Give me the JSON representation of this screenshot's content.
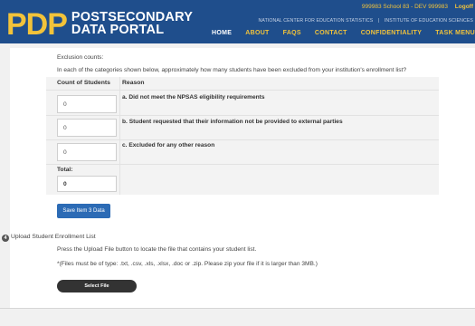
{
  "header": {
    "logo_mark": "PDP",
    "logo_line1": "POSTSECONDARY",
    "logo_line2": "DATA PORTAL",
    "session": "999983 School 83 - DEV 999983",
    "logoff": "Logoff",
    "org_left": "NATIONAL CENTER FOR EDUCATION STATISTICS",
    "org_sep": "|",
    "org_right": "INSTITUTE OF EDUCATION SCIENCES",
    "nav": [
      "HOME",
      "ABOUT",
      "FAQS",
      "CONTACT",
      "CONFIDENTIALITY",
      "TASK MENU"
    ]
  },
  "exclusion": {
    "heading": "Exclusion counts:",
    "question": "In each of the categories shown below, approximately how many students have been excluded from your institution's enrollment list?",
    "col_count": "Count of Students",
    "col_reason": "Reason",
    "rows": [
      {
        "value": "0",
        "reason": "a. Did not meet the NPSAS eligibility requirements"
      },
      {
        "value": "0",
        "reason": "b. Student requested that their information not be provided to external parties"
      },
      {
        "value": "0",
        "reason": "c. Excluded for any other reason"
      }
    ],
    "total_label": "Total:",
    "total_value": "0",
    "save_label": "Save Item 3 Data"
  },
  "upload": {
    "step_number": "4",
    "title": "Upload Student Enrollment List",
    "instruction": "Press the Upload File button to locate the file that contains your student list.",
    "file_note": "*(Files must be of type: .txt, .csv, .xls, .xlsx, .doc or .zip. Please zip your file if it is larger than 3MB.)",
    "select_label": "Select File"
  },
  "colors": {
    "header_bg": "#1f4e8c",
    "accent_gold": "#f2c33a",
    "button_blue": "#2c6bb5"
  }
}
